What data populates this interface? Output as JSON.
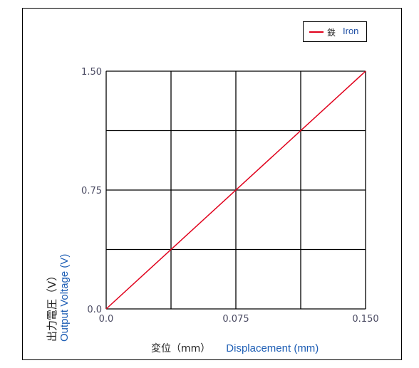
{
  "chart_data": {
    "type": "line",
    "title": "",
    "xlabel_jp": "変位（mm）",
    "xlabel_en": "Displacement (mm)",
    "ylabel_jp": "出力電圧（V）",
    "ylabel_en": "Output Voltage (V)",
    "xlim": [
      0.0,
      0.15
    ],
    "ylim": [
      0.0,
      1.5
    ],
    "x_ticks": [
      0.0,
      0.0375,
      0.075,
      0.1125,
      0.15
    ],
    "x_tick_labels": [
      "0.0",
      "",
      "0.075",
      "",
      "0.150"
    ],
    "y_ticks": [
      0.0,
      0.375,
      0.75,
      1.125,
      1.5
    ],
    "y_tick_labels": [
      "0.0",
      "",
      "0.75",
      "",
      "1.50"
    ],
    "grid": true,
    "legend_position": "top-right",
    "series": [
      {
        "name_jp": "鉄",
        "name_en": "Iron",
        "color": "#e0001b",
        "x": [
          0.0,
          0.15
        ],
        "y": [
          0.0,
          1.5
        ]
      }
    ]
  }
}
